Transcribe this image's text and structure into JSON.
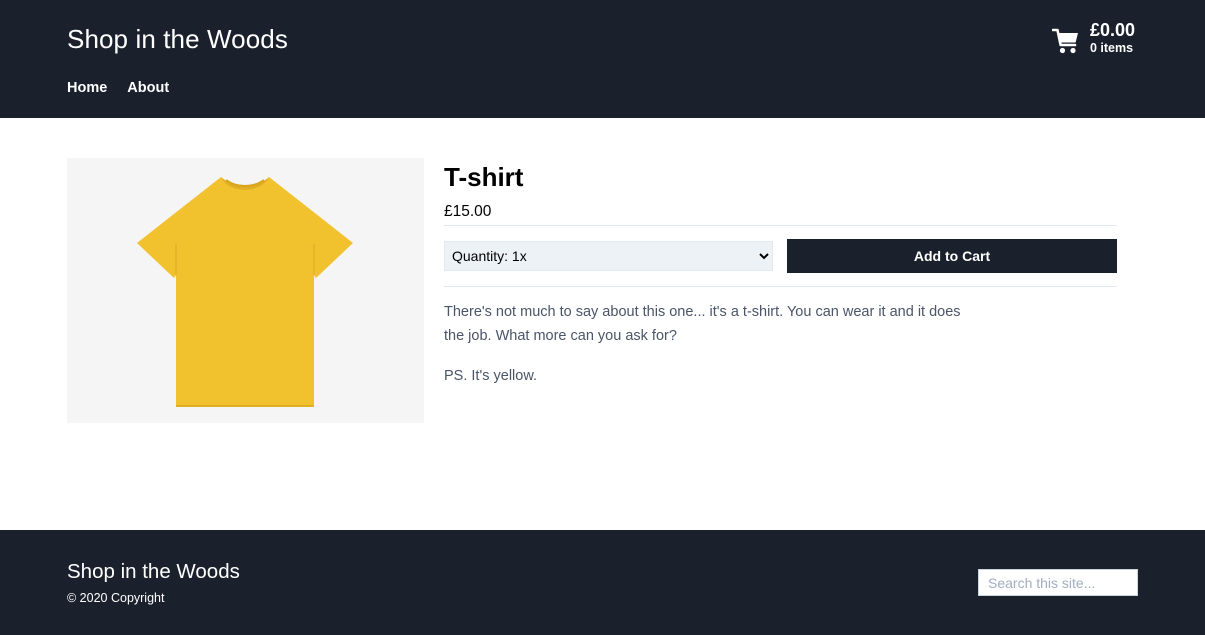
{
  "header": {
    "site_title": "Shop in the Woods",
    "nav": [
      {
        "label": "Home"
      },
      {
        "label": "About"
      }
    ],
    "cart": {
      "icon": "cart-icon",
      "total": "£0.00",
      "count": "0 items"
    }
  },
  "product": {
    "title": "T-shirt",
    "price": "£15.00",
    "quantity_selected": "Quantity: 1x",
    "add_to_cart_label": "Add to Cart",
    "description": [
      "There's not much to say about this one... it's a t-shirt. You can wear it and it does the job. What more can you ask for?",
      "PS. It's yellow."
    ],
    "image_color": "#f2c12e"
  },
  "footer": {
    "title": "Shop in the Woods",
    "copyright": "© 2020 Copyright",
    "search_placeholder": "Search this site..."
  },
  "colors": {
    "header_bg": "#1a202c",
    "button_bg": "#1a202c",
    "image_bg": "#f5f5f5",
    "select_bg": "#edf2f7"
  }
}
